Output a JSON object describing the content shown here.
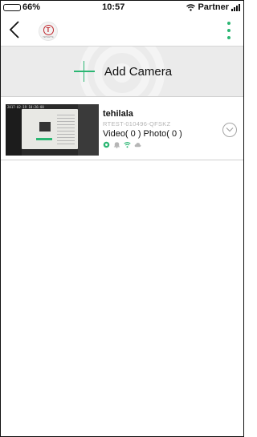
{
  "status_bar": {
    "battery": "66%",
    "time": "10:57",
    "carrier": "Partner"
  },
  "nav": {
    "logo_letter": "T",
    "logo_text": "TEHILETTE"
  },
  "add_camera": {
    "label": "Add Camera"
  },
  "cameras": [
    {
      "name": "tehilala",
      "id": "RTEST-010496-QFSKZ",
      "counts": "Video( 0 )  Photo( 0 )",
      "thumbnail_timestamp": "2017-02-19 10:26:00",
      "status_icons": [
        "camera-icon",
        "bell-icon",
        "wifi-icon",
        "cloud-icon"
      ]
    }
  ],
  "colors": {
    "accent": "#2bb673",
    "logo_red": "#c0282e",
    "banner_bg": "#ebebeb"
  }
}
